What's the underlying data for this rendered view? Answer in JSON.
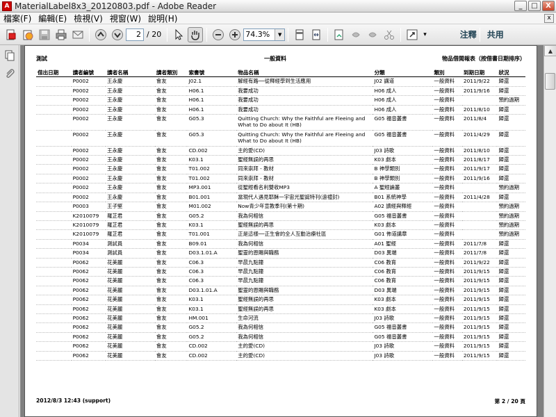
{
  "window": {
    "app_icon_glyph": "A",
    "title": "MaterialLabel8x3_20120803.pdf - Adobe Reader",
    "buttons": {
      "minimize": "_",
      "maximize": "□",
      "close": "X"
    }
  },
  "menubar": {
    "items": [
      "檔案(F)",
      "編輯(E)",
      "檢視(V)",
      "視窗(W)",
      "說明(H)"
    ],
    "close_glyph": "x"
  },
  "toolbar": {
    "page_current": "2",
    "page_total": "/ 20",
    "zoom": "74.3%",
    "zoom_drop_glyph": "▼",
    "more_glyph": "▾",
    "comment_label": "注釋",
    "share_label": "共用",
    "icons": [
      "create-pdf-icon",
      "pdf-manage-icon",
      "save-icon",
      "print-icon",
      "email-icon",
      "prev-page-icon",
      "next-page-icon",
      "select-tool-icon",
      "hand-tool-icon",
      "zoom-out-icon",
      "zoom-in-icon",
      "fit-page-icon",
      "fit-width-icon",
      "sign-icon",
      "undo-icon",
      "redo-icon",
      "cut-icon",
      "fullscreen-icon"
    ]
  },
  "sidebar": {
    "icons": [
      "pages-panel-icon",
      "attachments-icon"
    ]
  },
  "scrollbar": {
    "up_glyph": "▲"
  },
  "report": {
    "header_left": "測試",
    "header_center": "一般資料",
    "header_right": "物品借閱報表（按借書日期排序）",
    "columns": [
      "借出日期",
      "讀者編號",
      "讀者名稱",
      "讀者類別",
      "索書號",
      "物品名稱",
      "分類",
      "類別",
      "到期日期",
      "狀況"
    ],
    "rows": [
      [
        "",
        "P0002",
        "王永慶",
        "會友",
        "J02.1",
        "解經有路──從釋經學到生活應用",
        "J02 講道",
        "一般資料",
        "2011/9/22",
        "歸還"
      ],
      [
        "",
        "P0002",
        "王永慶",
        "會友",
        "H06.1",
        "我要成功",
        "H06 成人",
        "一般資料",
        "2011/9/16",
        "歸還"
      ],
      [
        "",
        "P0002",
        "王永慶",
        "會友",
        "H06.1",
        "我要成功",
        "H06 成人",
        "一般資料",
        "",
        "預約過期"
      ],
      [
        "",
        "P0002",
        "王永慶",
        "會友",
        "H06.1",
        "我要成功",
        "H06 成人",
        "一般資料",
        "2011/8/10",
        "歸還"
      ],
      [
        "",
        "P0002",
        "王永慶",
        "會友",
        "G05.3",
        "Quitting Church: Why the Faithful are Fleeing and What to Do about It (HB)",
        "G05 福音叢書",
        "一般資料",
        "2011/8/4",
        "歸還"
      ],
      [
        "",
        "P0002",
        "王永慶",
        "會友",
        "G05.3",
        "Quitting Church: Why the Faithful are Fleeing and What to Do about It (HB)",
        "G05 福音叢書",
        "一般資料",
        "2011/4/29",
        "歸還"
      ],
      [
        "",
        "P0002",
        "王永慶",
        "會友",
        "CD.002",
        "主的愛(CD)",
        "J03 詩歌",
        "一般資料",
        "2011/8/10",
        "歸還"
      ],
      [
        "",
        "P0002",
        "王永慶",
        "會友",
        "K03.1",
        "聖經無誤的再思",
        "K03 劇本",
        "一般資料",
        "2011/8/17",
        "歸還"
      ],
      [
        "",
        "P0002",
        "王永慶",
        "會友",
        "T01.002",
        "同來崇拜 - 教材",
        "B 神學類別",
        "一般資料",
        "2011/9/17",
        "歸還"
      ],
      [
        "",
        "P0002",
        "王永慶",
        "會友",
        "T01.002",
        "同來崇拜 - 教材",
        "B 神學類別",
        "一般資料",
        "2011/9/16",
        "歸還"
      ],
      [
        "",
        "P0002",
        "王永慶",
        "會友",
        "MP3.001",
        "從聖經看名利雙收MP3",
        "A 聖經論叢",
        "一般資料",
        "",
        "預約過期"
      ],
      [
        "",
        "P0002",
        "王永慶",
        "會友",
        "B01.001",
        "當現代人遇見耶穌一宇宙光聖誕特刊(遠禮封)",
        "B01 系統神學",
        "一般資料",
        "2011/4/28",
        "歸還"
      ],
      [
        "",
        "P0003",
        "王子堅",
        "會友",
        "M01.002",
        "Now青少年宣教季刊(第十期)",
        "A02 讀經與釋經",
        "一般資料",
        "",
        "預約過期"
      ],
      [
        "",
        "K2010079",
        "羅芷君",
        "會友",
        "G05.2",
        "我為何相信",
        "G05 福音叢書",
        "一般資料",
        "",
        "預約過期"
      ],
      [
        "",
        "K2010079",
        "羅芷君",
        "會友",
        "K03.1",
        "聖經無誤的再思",
        "K03 劇本",
        "一般資料",
        "",
        "預約過期"
      ],
      [
        "",
        "K2010079",
        "羅芷君",
        "會友",
        "T01.001",
        "正是這樣──正生會的全人互動治療社區",
        "G01 佈道講章",
        "一般資料",
        "",
        "預約過期"
      ],
      [
        "",
        "P0034",
        "測試員",
        "會友",
        "B09.01",
        "我為何相信",
        "A01 聖經",
        "一般資料",
        "2011/7/8",
        "歸還"
      ],
      [
        "",
        "P0034",
        "測試員",
        "會友",
        "D03.1.01.A",
        "聖靈的恩賜與職務",
        "D03 異端",
        "一般資料",
        "2011/7/8",
        "歸還"
      ],
      [
        "",
        "P0062",
        "花美麗",
        "會友",
        "C06.3",
        "早晨九點鐘",
        "C06 教育",
        "一般資料",
        "2011/9/22",
        "歸還"
      ],
      [
        "",
        "P0062",
        "花美麗",
        "會友",
        "C06.3",
        "早晨九點鐘",
        "C06 教育",
        "一般資料",
        "2011/9/15",
        "歸還"
      ],
      [
        "",
        "P0062",
        "花美麗",
        "會友",
        "C06.3",
        "早晨九點鐘",
        "C06 教育",
        "一般資料",
        "2011/9/15",
        "歸還"
      ],
      [
        "",
        "P0062",
        "花美麗",
        "會友",
        "D03.1.01.A",
        "聖靈的恩賜與職務",
        "D03 異端",
        "一般資料",
        "2011/9/15",
        "歸還"
      ],
      [
        "",
        "P0062",
        "花美麗",
        "會友",
        "K03.1",
        "聖經無誤的再思",
        "K03 劇本",
        "一般資料",
        "2011/9/15",
        "歸還"
      ],
      [
        "",
        "P0062",
        "花美麗",
        "會友",
        "K03.1",
        "聖經無誤的再思",
        "K03 劇本",
        "一般資料",
        "2011/9/15",
        "歸還"
      ],
      [
        "",
        "P0062",
        "花美麗",
        "會友",
        "HM.001",
        "生命河流",
        "J03 詩歌",
        "一般資料",
        "2011/9/15",
        "歸還"
      ],
      [
        "",
        "P0062",
        "花美麗",
        "會友",
        "G05.2",
        "我為何相信",
        "G05 福音叢書",
        "一般資料",
        "2011/9/15",
        "歸還"
      ],
      [
        "",
        "P0062",
        "花美麗",
        "會友",
        "G05.2",
        "我為何相信",
        "G05 福音叢書",
        "一般資料",
        "2011/9/15",
        "歸還"
      ],
      [
        "",
        "P0062",
        "花美麗",
        "會友",
        "CD.002",
        "主的愛(CD)",
        "J03 詩歌",
        "一般資料",
        "2011/9/15",
        "歸還"
      ],
      [
        "",
        "P0062",
        "花美麗",
        "會友",
        "CD.002",
        "主的愛(CD)",
        "J03 詩歌",
        "一般資料",
        "2011/9/15",
        "歸還"
      ]
    ],
    "footer_left": "2012/8/3 12:43 (support)",
    "footer_right": "第 2 / 20 頁"
  }
}
